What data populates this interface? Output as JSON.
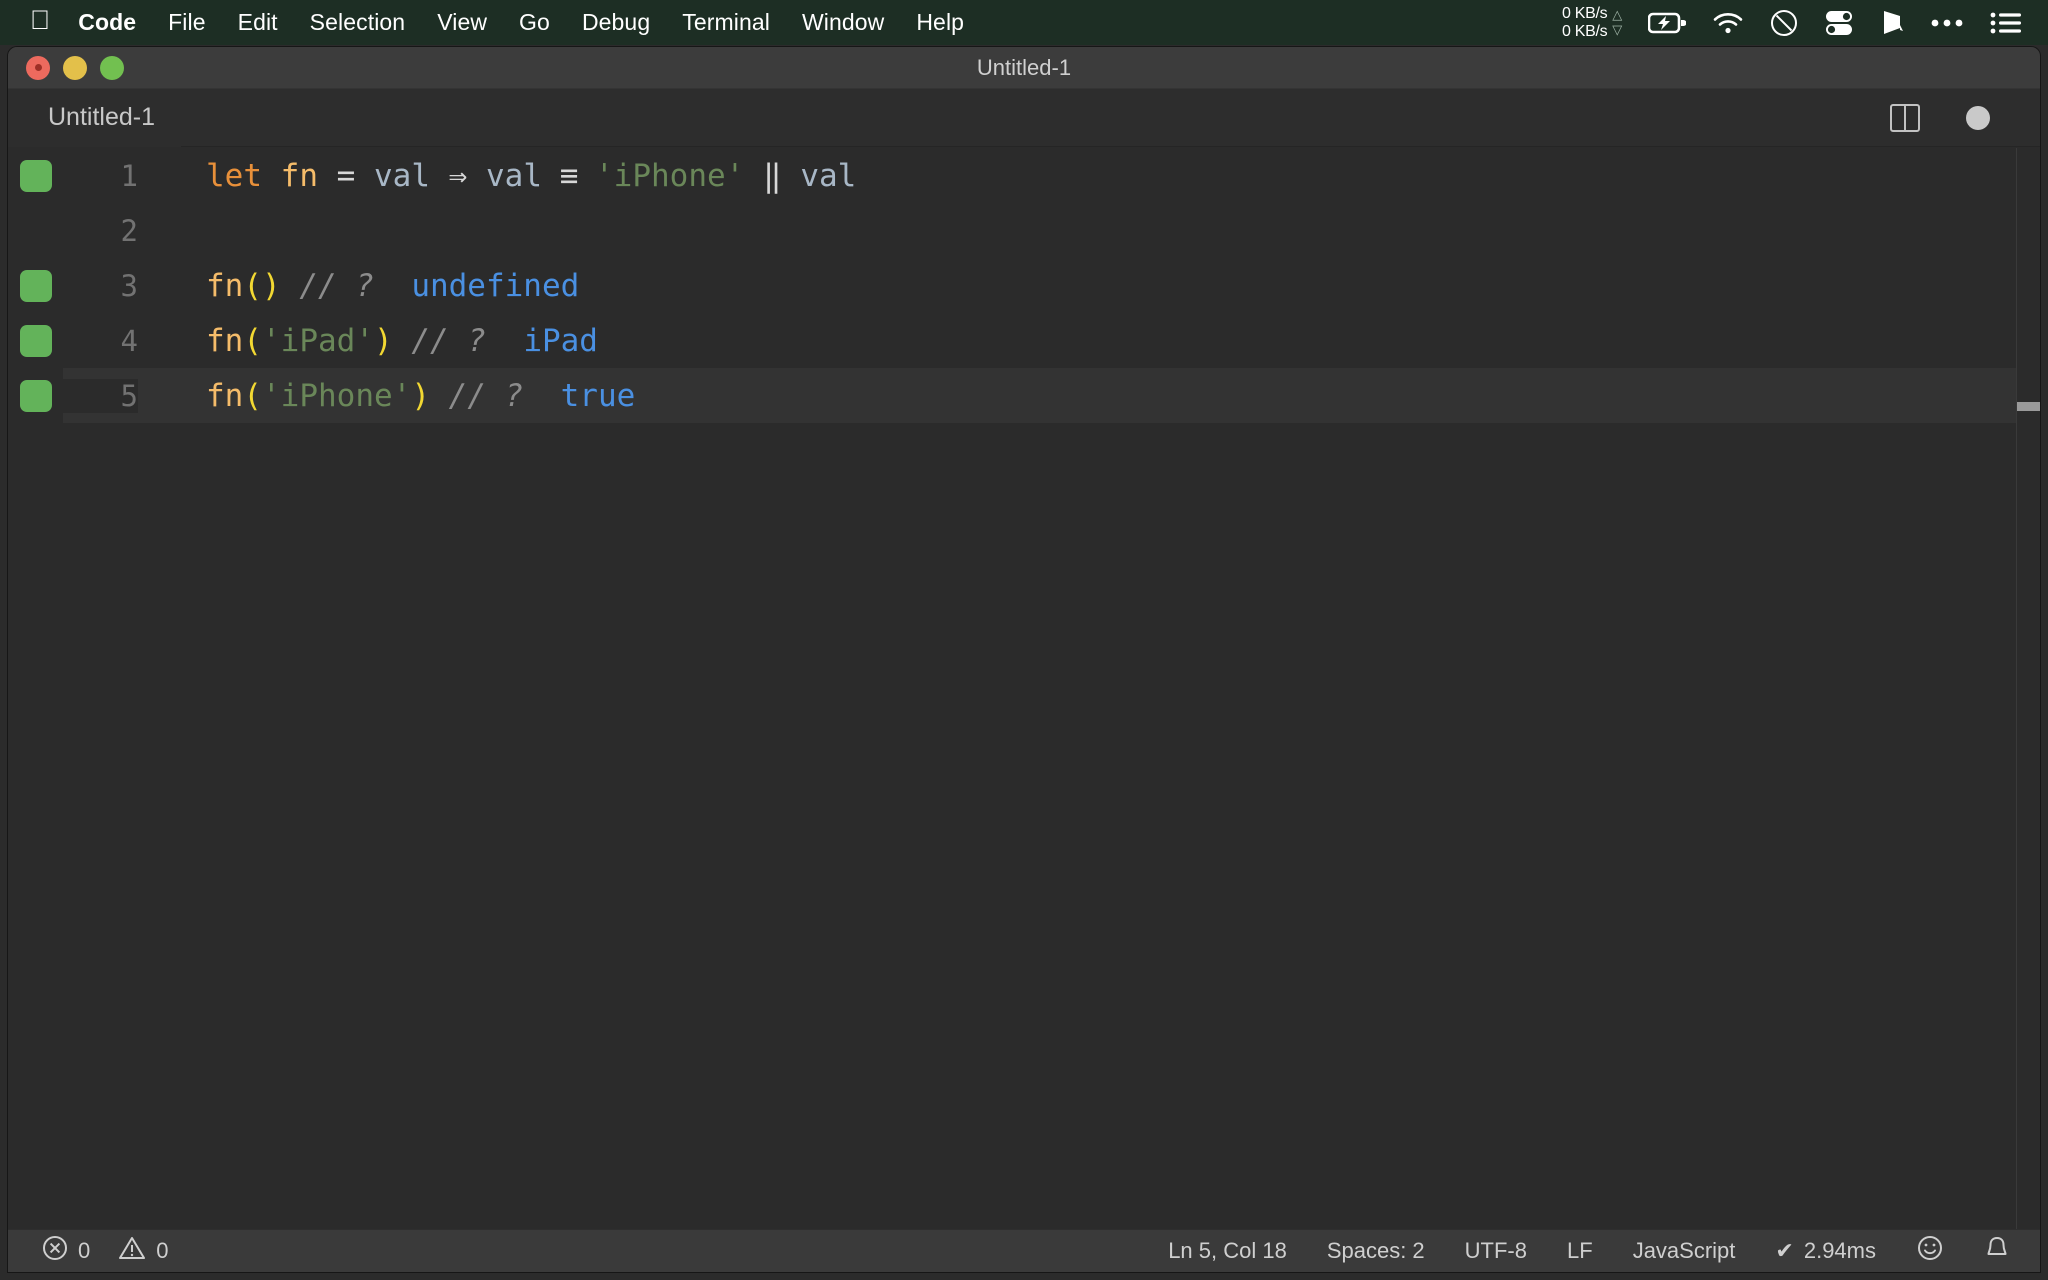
{
  "menubar": {
    "apple_icon": "apple-logo-icon",
    "items": [
      {
        "label": "Code",
        "bold": true
      },
      {
        "label": "File",
        "bold": false
      },
      {
        "label": "Edit",
        "bold": false
      },
      {
        "label": "Selection",
        "bold": false
      },
      {
        "label": "View",
        "bold": false
      },
      {
        "label": "Go",
        "bold": false
      },
      {
        "label": "Debug",
        "bold": false
      },
      {
        "label": "Terminal",
        "bold": false
      },
      {
        "label": "Window",
        "bold": false
      },
      {
        "label": "Help",
        "bold": false
      }
    ],
    "network": {
      "upload_rate": "0 KB/s",
      "download_rate": "0 KB/s",
      "up_arrow": "△",
      "down_arrow": "▽"
    },
    "status_icons": [
      "battery-charging-icon",
      "wifi-icon",
      "do-not-disturb-icon",
      "toggles-icon",
      "pennant-icon",
      "ellipsis-icon",
      "control-center-list-icon"
    ]
  },
  "window": {
    "title": "Untitled-1",
    "traffic_lights": [
      "close-button",
      "minimize-button",
      "maximize-button"
    ]
  },
  "tabbar": {
    "tab_label": "Untitled-1",
    "split_editor_icon": "split-editor-icon",
    "unsaved_indicator": "unsaved-dot-icon"
  },
  "editor": {
    "language": "JavaScript",
    "lines": [
      {
        "number": "1",
        "marker": true,
        "current": false,
        "tokens": [
          {
            "text": "let",
            "cls": "t-kw"
          },
          {
            "text": " ",
            "cls": "t-op"
          },
          {
            "text": "fn",
            "cls": "t-fn"
          },
          {
            "text": " = ",
            "cls": "t-op"
          },
          {
            "text": "val",
            "cls": "t-var"
          },
          {
            "text": " ⇒ ",
            "cls": "t-op"
          },
          {
            "text": "val",
            "cls": "t-var"
          },
          {
            "text": " ≡ ",
            "cls": "t-op lig"
          },
          {
            "text": "'iPhone'",
            "cls": "t-str"
          },
          {
            "text": " ‖ ",
            "cls": "t-op"
          },
          {
            "text": "val",
            "cls": "t-var"
          }
        ]
      },
      {
        "number": "2",
        "marker": false,
        "current": false,
        "tokens": []
      },
      {
        "number": "3",
        "marker": true,
        "current": false,
        "tokens": [
          {
            "text": "fn",
            "cls": "t-fn"
          },
          {
            "text": "()",
            "cls": "t-paren"
          },
          {
            "text": " ",
            "cls": "t-op"
          },
          {
            "text": "// ?",
            "cls": "t-com"
          },
          {
            "text": "  ",
            "cls": "t-op"
          },
          {
            "text": "undefined",
            "cls": "t-res"
          }
        ]
      },
      {
        "number": "4",
        "marker": true,
        "current": false,
        "tokens": [
          {
            "text": "fn",
            "cls": "t-fn"
          },
          {
            "text": "(",
            "cls": "t-paren"
          },
          {
            "text": "'iPad'",
            "cls": "t-str"
          },
          {
            "text": ")",
            "cls": "t-paren"
          },
          {
            "text": " ",
            "cls": "t-op"
          },
          {
            "text": "// ?",
            "cls": "t-com"
          },
          {
            "text": "  ",
            "cls": "t-op"
          },
          {
            "text": "iPad",
            "cls": "t-res"
          }
        ]
      },
      {
        "number": "5",
        "marker": true,
        "current": true,
        "tokens": [
          {
            "text": "fn",
            "cls": "t-fn"
          },
          {
            "text": "(",
            "cls": "t-paren"
          },
          {
            "text": "'iPhone'",
            "cls": "t-str"
          },
          {
            "text": ")",
            "cls": "t-paren"
          },
          {
            "text": " ",
            "cls": "t-op"
          },
          {
            "text": "// ?",
            "cls": "t-com"
          },
          {
            "text": "  ",
            "cls": "t-op"
          },
          {
            "text": "true",
            "cls": "t-res"
          }
        ]
      }
    ]
  },
  "statusbar": {
    "errors_icon": "error-circle-icon",
    "errors_count": "0",
    "warnings_icon": "warning-triangle-icon",
    "warnings_count": "0",
    "cursor_position": "Ln 5, Col 18",
    "indentation": "Spaces: 2",
    "encoding": "UTF-8",
    "eol": "LF",
    "language_mode": "JavaScript",
    "run_check": "✔",
    "run_time": "2.94ms",
    "feedback_icon": "smiley-icon",
    "notifications_icon": "bell-icon"
  },
  "colors": {
    "menubar_bg": "#1d2e24",
    "titlebar_bg": "#3c3c3c",
    "editor_bg": "#2b2b2b",
    "current_line_bg": "#333333",
    "statusbar_bg": "#3a3a3a",
    "marker_green": "#63b35a",
    "result_blue": "#4a90e2",
    "string_green": "#6a8759",
    "keyword_orange": "#e8903a",
    "paren_yellow": "#f2d832"
  }
}
